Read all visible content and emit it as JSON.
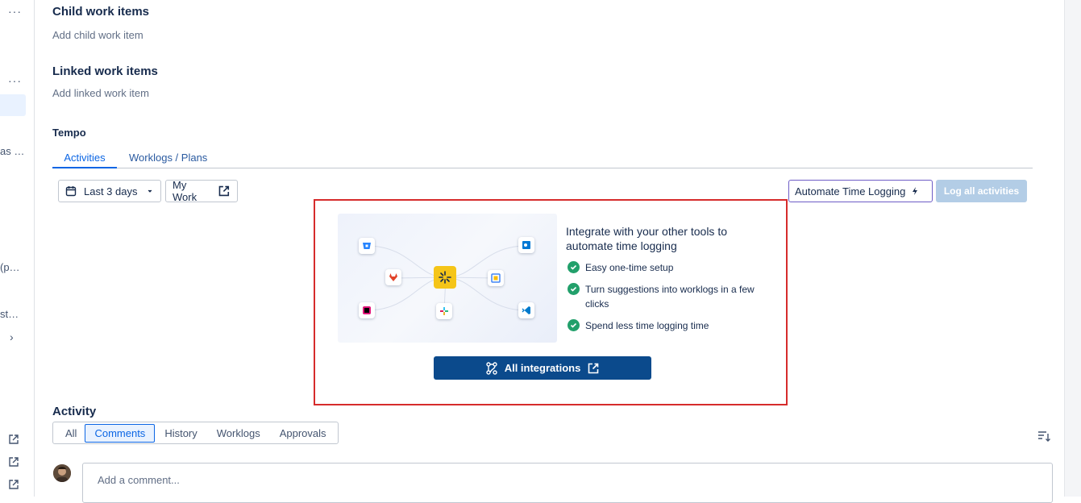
{
  "sidebar": {
    "truncated_texts": [
      "as …",
      "(p…",
      "st…"
    ]
  },
  "sections": {
    "child": {
      "title": "Child work items",
      "placeholder": "Add child work item"
    },
    "linked": {
      "title": "Linked work items",
      "placeholder": "Add linked work item"
    }
  },
  "tempo": {
    "title": "Tempo",
    "tabs": [
      {
        "label": "Activities",
        "active": true
      },
      {
        "label": "Worklogs / Plans",
        "active": false
      }
    ],
    "date_filter": "Last 3 days",
    "my_work": "My Work",
    "automate_button": "Automate Time Logging",
    "log_all_button": "Log all activities",
    "promo": {
      "title": "Integrate with your other tools to automate time logging",
      "benefits": [
        "Easy one-time setup",
        "Turn suggestions into worklogs in a few clicks",
        "Spend less time logging time"
      ],
      "button": "All integrations",
      "apps": [
        "bitbucket-icon",
        "gitlab-icon",
        "jira-icon",
        "outlook-icon",
        "google-calendar-icon",
        "slack-icon",
        "jetbrains-icon",
        "vscode-icon"
      ]
    }
  },
  "activity": {
    "title": "Activity",
    "filters": [
      {
        "label": "All",
        "selected": false
      },
      {
        "label": "Comments",
        "selected": true
      },
      {
        "label": "History",
        "selected": false
      },
      {
        "label": "Worklogs",
        "selected": false
      },
      {
        "label": "Approvals",
        "selected": false
      }
    ],
    "comment_placeholder": "Add a comment..."
  },
  "colors": {
    "accent": "#0c66e4",
    "primary_button": "#0b4a8c",
    "promo_border": "#d62c2c",
    "success": "#22a06b",
    "hub": "#f5c518"
  }
}
